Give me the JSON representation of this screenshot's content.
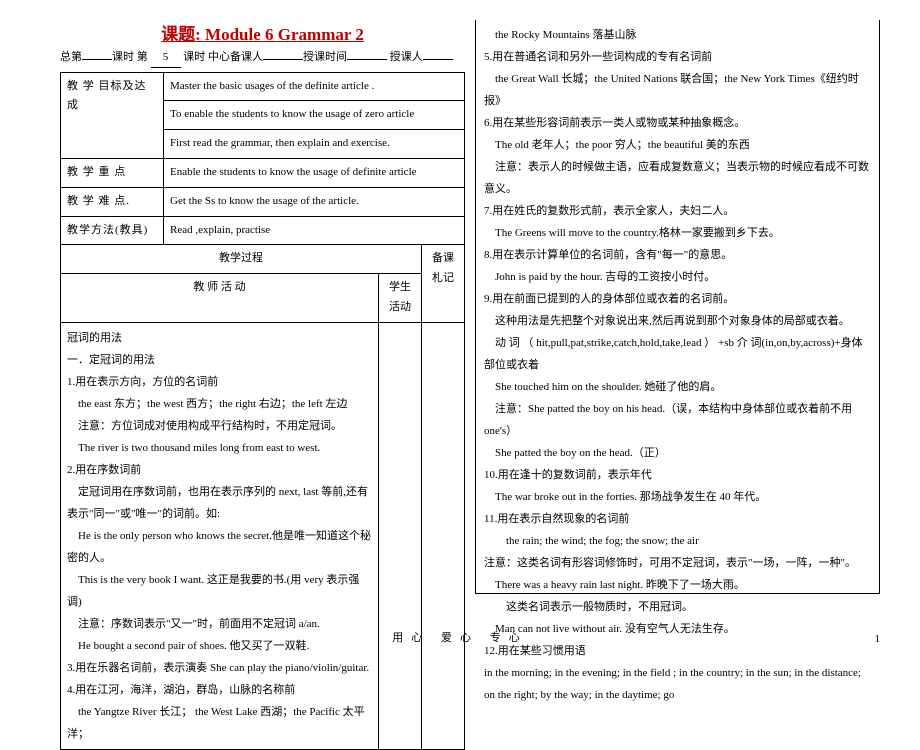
{
  "title": "课题: Module 6 Grammar 2",
  "meta": {
    "prefix": "总第",
    "blank1": "",
    "mid1": "课时 第",
    "num": "5",
    "mid2": "课时 中心备课人",
    "blank2": "",
    "mid3": "授课时间",
    "blank3": "",
    "mid4": "授课人",
    "blank4": ""
  },
  "rows": {
    "r1label": "教 学 目标及达成",
    "r1a": "Master the basic usages of the definite article .",
    "r1b": "To enable the students to know the usage of zero article",
    "r1c": "First read the grammar, then explain and exercise.",
    "r2label": "教 学 重 点",
    "r2": "Enable the students to know the usage of definite article",
    "r3label": "教 学 难 点.",
    "r3": "Get the Ss to know the usage of the article.",
    "r4label": "教学方法(教具)",
    "r4": "Read ,explain, practise"
  },
  "process": {
    "header": "教学过程",
    "side": "备课札记",
    "teacher": "教 师 活 动",
    "student": "学生活动"
  },
  "left_content": {
    "l1": "冠词的用法",
    "l2": "一．定冠词的用法",
    "l3": "1.用在表示方向，方位的名词前",
    "l4": "the east 东方；the west 西方；the right 右边；the left 左边",
    "l5": "注意：方位词成对使用构成平行结构时，不用定冠词。",
    "l6": "The river is two thousand miles long from east to west.",
    "l7": "2.用在序数词前",
    "l8": "定冠词用在序数词前，也用在表示序列的 next, last 等前,还有表示\"同一\"或\"唯一\"的词前。如:",
    "l9": "He is the only person who knows the secret.他是唯一知道这个秘密的人。",
    "l10": "This is the very book I want. 这正是我要的书.(用 very 表示强调)",
    "l11": "注意：序数词表示\"又一\"时，前面用不定冠词 a/an.",
    "l12": "He bought a second pair of shoes. 他又买了一双鞋.",
    "l13": "3.用在乐器名词前，表示演奏  She can play the piano/violin/guitar.",
    "l14": "4.用在江河，海洋，湖泊，群岛，山脉的名称前",
    "l15": "the Yangtze River 长江； the West Lake 西湖；the Pacific 太平洋；"
  },
  "right_content": {
    "r1": "the Rocky Mountains 落基山脉",
    "r2": "5.用在普通名词和另外一些词构成的专有名词前",
    "r3": "the Great Wall 长城；the United Nations 联合国；the New York Times《纽约时报》",
    "r4": "6.用在某些形容词前表示一类人或物或某种抽象概念。",
    "r5": "The old 老年人；the poor 穷人；the beautiful 美的东西",
    "r6": "注意：表示人的时候做主语，应看成复数意义；当表示物的时候应看成不可数意义。",
    "r7": "7.用在姓氏的复数形式前，表示全家人，夫妇二人。",
    "r8": "The Greens will move to the country.格林一家要搬到乡下去。",
    "r9": "8.用在表示计算单位的名词前，含有\"每一\"的意思。",
    "r10": "John is paid by the hour. 吉母的工资按小时付。",
    "r11": "9.用在前面已提到的人的身体部位或衣着的名词前。",
    "r12": "这种用法是先把整个对象说出来,然后再说到那个对象身体的局部或衣着。",
    "r13": "动 词 （ hit,pull,pat,strike,catch,hold,take,lead ） +sb 介 词(in,on,by,across)+身体部位或衣着",
    "r14": "She touched him on the shoulder. 她碰了他的肩。",
    "r15": "注意：She patted the boy on his head.（误，本结构中身体部位或衣着前不用 one's）",
    "r16": "She patted the boy on the head.（正）",
    "r17": "10.用在逢十的复数词前，表示年代",
    "r18": "The war broke out in the forties. 那场战争发生在 40 年代。",
    "r19": "11.用在表示自然现象的名词前",
    "r20": "the rain; the wind; the fog; the snow; the air",
    "r21": "注意：这类名词有形容词修饰时，可用不定冠词，表示\"一场，一阵，一种\"。",
    "r22": "There was a heavy rain last night. 昨晚下了一场大雨。",
    "r23": "这类名词表示一般物质时，不用冠词。",
    "r24": "Man can not live without air. 没有空气人无法生存。",
    "r25": "12.用在某些习惯用语",
    "r26": "in the morning; in the evening; in the field ; in the country; in the sun; in the distance; on the right; by the way; in the daytime; go"
  },
  "footer": "用心 爱心 专心",
  "pagenum": "1"
}
